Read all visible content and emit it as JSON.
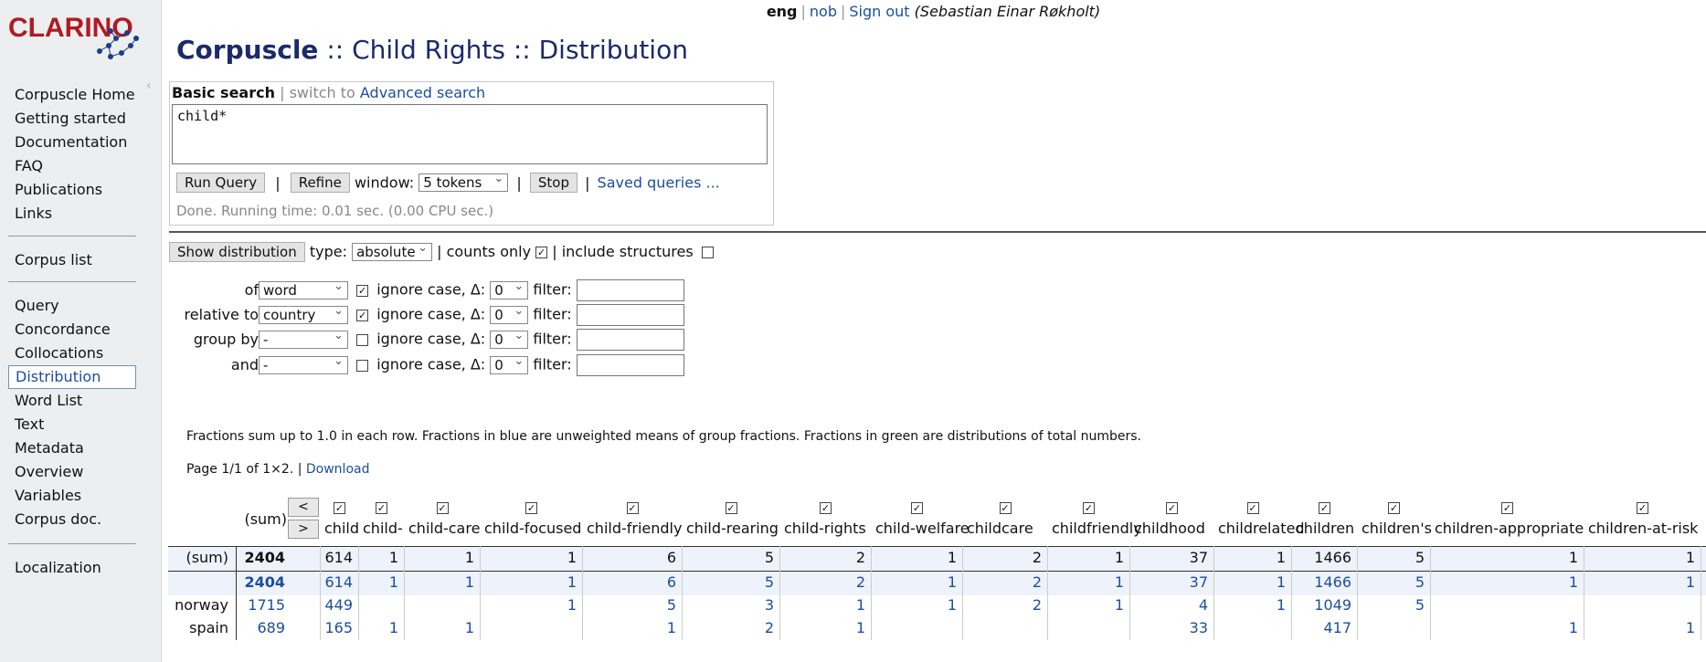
{
  "header": {
    "langs": [
      {
        "label": "eng"
      },
      {
        "label": "nob"
      }
    ],
    "sign_out": "Sign out",
    "user": "(Sebastian Einar Røkholt)",
    "title_brand": "Corpuscle",
    "title_rest": ":: Child Rights :: Distribution",
    "logo_text": "CLARINO"
  },
  "sidebar": {
    "group1": [
      "Corpuscle Home",
      "Getting started",
      "Documentation",
      "FAQ",
      "Publications",
      "Links"
    ],
    "group2": [
      "Corpus list"
    ],
    "group3": [
      "Query",
      "Concordance",
      "Collocations",
      "Distribution",
      "Word List",
      "Text",
      "Metadata",
      "Overview",
      "Variables",
      "Corpus doc."
    ],
    "group4": [
      "Localization"
    ],
    "active": "Distribution"
  },
  "search": {
    "mode": "Basic search",
    "switch_prefix": "| switch to",
    "switch_link": "Advanced search",
    "query": "child*",
    "run_label": "Run Query",
    "refine_label": "Refine",
    "window_label": "window:",
    "window_value": "5 tokens",
    "stop_label": "Stop",
    "saved_queries": "Saved queries ...",
    "status": "Done. Running time: 0.01 sec. (0.00 CPU sec.)"
  },
  "distribution": {
    "show_label": "Show distribution",
    "type_label": "type:",
    "type_value": "absolute",
    "counts_only_label": "counts only",
    "counts_only": true,
    "include_structures_label": "include structures",
    "include_structures": false,
    "ignore_case_label": "ignore case, Δ:",
    "filter_label": "filter:",
    "fields": [
      {
        "label": "of",
        "value": "word",
        "ignore_case": true,
        "delta": "0"
      },
      {
        "label": "relative to",
        "value": "country",
        "ignore_case": true,
        "delta": "0"
      },
      {
        "label": "group by",
        "value": "-",
        "ignore_case": false,
        "delta": "0"
      },
      {
        "label": "and",
        "value": "-",
        "ignore_case": false,
        "delta": "0"
      }
    ],
    "note": "Fractions sum up to 1.0 in each row. Fractions in blue are unweighted means of group fractions. Fractions in green are distributions of total numbers.",
    "page_info": "Page 1/1 of 1×2.",
    "download": "Download"
  },
  "table": {
    "sum_label": "(sum)",
    "prev": "<",
    "next": ">",
    "columns": [
      "child",
      "child-",
      "child-care",
      "child-focused",
      "child-friendly",
      "child-rearing",
      "child-rights",
      "child-welfare",
      "childcare",
      "childfriendly",
      "childhood",
      "childrelated",
      "children",
      "children's",
      "children-appropriate",
      "children-at-risk"
    ],
    "sum_row": {
      "label": "(sum)",
      "total": "2404",
      "values": [
        "614",
        "1",
        "1",
        "1",
        "6",
        "5",
        "2",
        "1",
        "2",
        "1",
        "37",
        "1",
        "1466",
        "5",
        "1",
        "1"
      ]
    },
    "total_row": {
      "label": "",
      "total": "2404",
      "values": [
        "614",
        "1",
        "1",
        "1",
        "6",
        "5",
        "2",
        "1",
        "2",
        "1",
        "37",
        "1",
        "1466",
        "5",
        "1",
        "1"
      ]
    },
    "rows": [
      {
        "label": "norway",
        "total": "1715",
        "values": [
          "449",
          "",
          "",
          "1",
          "5",
          "3",
          "1",
          "1",
          "2",
          "1",
          "4",
          "1",
          "1049",
          "5",
          "",
          ""
        ]
      },
      {
        "label": "spain",
        "total": "689",
        "values": [
          "165",
          "1",
          "1",
          "",
          "1",
          "2",
          "1",
          "",
          "",
          "",
          "33",
          "",
          "417",
          "",
          "1",
          "1"
        ]
      }
    ]
  }
}
